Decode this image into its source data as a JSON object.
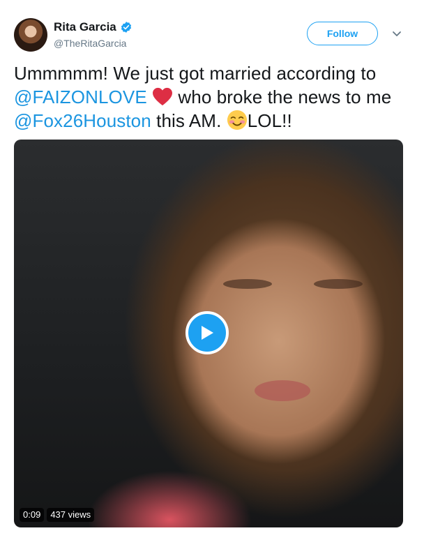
{
  "author": {
    "name": "Rita Garcia",
    "handle": "@TheRitaGarcia",
    "verified": true,
    "avatar_icon": "profile-photo"
  },
  "header": {
    "follow_label": "Follow",
    "menu_icon": "chevron-down-icon"
  },
  "tweet": {
    "part1": "Ummmmm! We just got married according to ",
    "mention1": "@FAIZONLOVE",
    "heart_emoji": "red-heart",
    "part2": " who broke the news to me ",
    "mention2": "@Fox26Houston",
    "part3": " this AM. ",
    "blush_emoji": "smiling-face-with-smiling-eyes",
    "part4": "LOL!!"
  },
  "video": {
    "duration": "0:09",
    "views": "437 views",
    "play_icon": "play-icon"
  },
  "colors": {
    "accent": "#1da1f2",
    "mention": "#1b95e0",
    "text": "#14171a",
    "muted": "#657786"
  }
}
